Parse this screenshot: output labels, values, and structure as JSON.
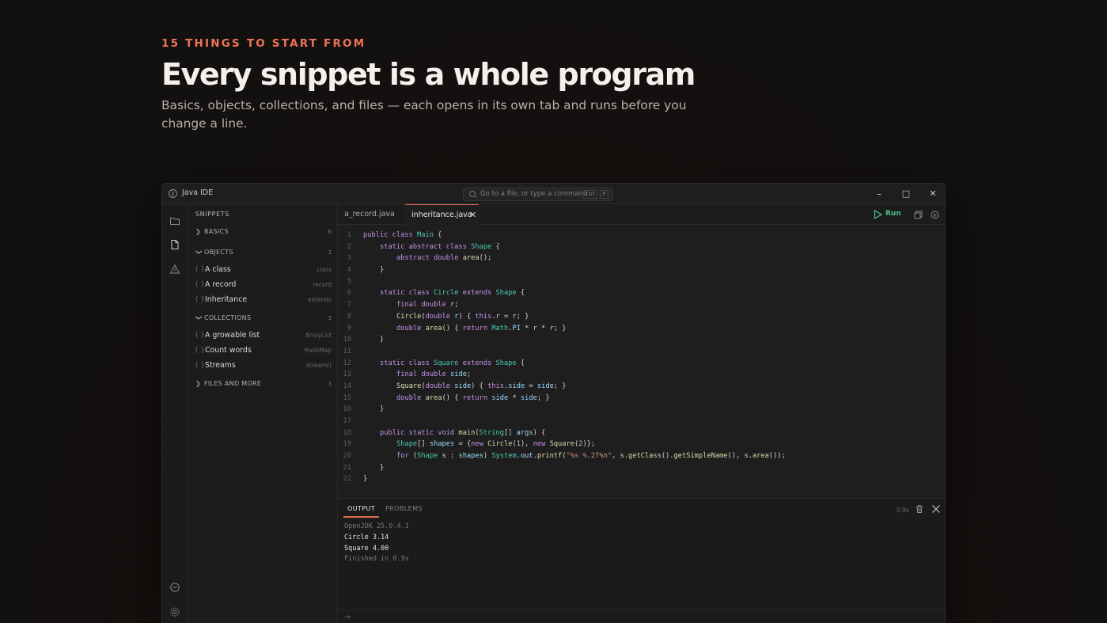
{
  "hero": {
    "eyebrow": "15 THINGS TO START FROM",
    "headline": "Every snippet is a whole program",
    "subtitle": "Basics, objects, collections, and files — each opens in its own tab and runs before you change a line."
  },
  "window": {
    "app_logo": "JJ",
    "title": "Java IDE",
    "command_placeholder": "Go to a file, or type a command",
    "shortcut_keys": [
      "Ctrl",
      "P"
    ],
    "controls": {
      "minimize": "–",
      "maximize": "□",
      "close": "✕"
    }
  },
  "activity_bar": {
    "icons": [
      "folder-icon",
      "file-icon",
      "warning-icon",
      "chat-icon",
      "gear-icon"
    ]
  },
  "sidebar": {
    "heading": "SNIPPETS",
    "groups": [
      {
        "label": "BASICS",
        "count": "6",
        "expanded": false,
        "items": []
      },
      {
        "label": "OBJECTS",
        "count": "3",
        "expanded": true,
        "items": [
          {
            "label": "A class",
            "hint": "class"
          },
          {
            "label": "A record",
            "hint": "record"
          },
          {
            "label": "Inheritance",
            "hint": "extends"
          }
        ]
      },
      {
        "label": "COLLECTIONS",
        "count": "3",
        "expanded": true,
        "items": [
          {
            "label": "A growable list",
            "hint": "ArrayList"
          },
          {
            "label": "Count words",
            "hint": "HashMap"
          },
          {
            "label": "Streams",
            "hint": "stream()"
          }
        ]
      },
      {
        "label": "FILES AND MORE",
        "count": "3",
        "expanded": false,
        "items": []
      }
    ],
    "braces": "{ }"
  },
  "tabs": [
    {
      "label": "a_record.java",
      "active": false
    },
    {
      "label": "inheritance.java",
      "active": true,
      "close": "✕"
    }
  ],
  "toolbar": {
    "run_label": "Run",
    "run_color": "#4fc38a",
    "accent_color": "#e06c4f"
  },
  "editor": {
    "lines": [
      "1",
      "2",
      "3",
      "4",
      "5",
      "6",
      "7",
      "8",
      "9",
      "10",
      "11",
      "12",
      "13",
      "14",
      "15",
      "16",
      "17",
      "18",
      "19",
      "20",
      "21",
      "22"
    ],
    "tokens": {
      "l1": [
        "public class ",
        "Main",
        " {"
      ],
      "l2": [
        "static abstract class ",
        "Shape",
        " {"
      ],
      "l3": [
        "abstract double ",
        "area",
        "();"
      ],
      "l4": [
        "}"
      ],
      "l6": [
        "static class ",
        "Circle",
        " extends ",
        "Shape",
        " {"
      ],
      "l7": [
        "final double ",
        "r",
        ";"
      ],
      "l8": [
        "Circle",
        "(",
        "double ",
        "r",
        ") { ",
        "this",
        ".",
        "r",
        " = ",
        "r",
        "; }"
      ],
      "l9": [
        "double ",
        "area",
        "() { ",
        "return ",
        "Math",
        ".",
        "PI",
        " * ",
        "r",
        " * ",
        "r",
        "; }"
      ],
      "l10": [
        "}"
      ],
      "l12": [
        "static class ",
        "Square",
        " extends ",
        "Shape",
        " {"
      ],
      "l13": [
        "final double ",
        "side",
        ";"
      ],
      "l14": [
        "Square",
        "(",
        "double ",
        "side",
        ") { ",
        "this",
        ".",
        "side",
        " = ",
        "side",
        "; }"
      ],
      "l15": [
        "double ",
        "area",
        "() { ",
        "return ",
        "side",
        " * ",
        "side",
        "; }"
      ],
      "l16": [
        "}"
      ],
      "l18": [
        "public static void ",
        "main",
        "(",
        "String",
        "[] ",
        "args",
        ") {"
      ],
      "l19": [
        "Shape",
        "[] ",
        "shapes",
        " = {",
        "new ",
        "Circle",
        "(",
        "1",
        "), ",
        "new ",
        "Square",
        "(",
        "2",
        ")};"
      ],
      "l20": [
        "for ",
        "(",
        "Shape",
        " s : ",
        "shapes",
        ") ",
        "System",
        ".",
        "out",
        ".",
        "printf",
        "(",
        "\"%s %.2f%n\"",
        ", s.",
        "getClass",
        "().",
        "getSimpleName",
        "(), s.",
        "area",
        "());"
      ],
      "l21": [
        "}"
      ],
      "l22": [
        "}"
      ]
    }
  },
  "panel": {
    "tabs": [
      {
        "label": "OUTPUT",
        "active": true
      },
      {
        "label": "PROBLEMS",
        "active": false
      }
    ],
    "duration": "0.9s",
    "output": [
      {
        "text": "OpenJDK 25.0.4.1",
        "style": "dim"
      },
      {
        "text": "Circle 3.14",
        "style": "bright"
      },
      {
        "text": "Square 4.00",
        "style": "bright"
      },
      {
        "text": "Finished in 0.9s",
        "style": "dim"
      }
    ],
    "prompt": "→"
  }
}
